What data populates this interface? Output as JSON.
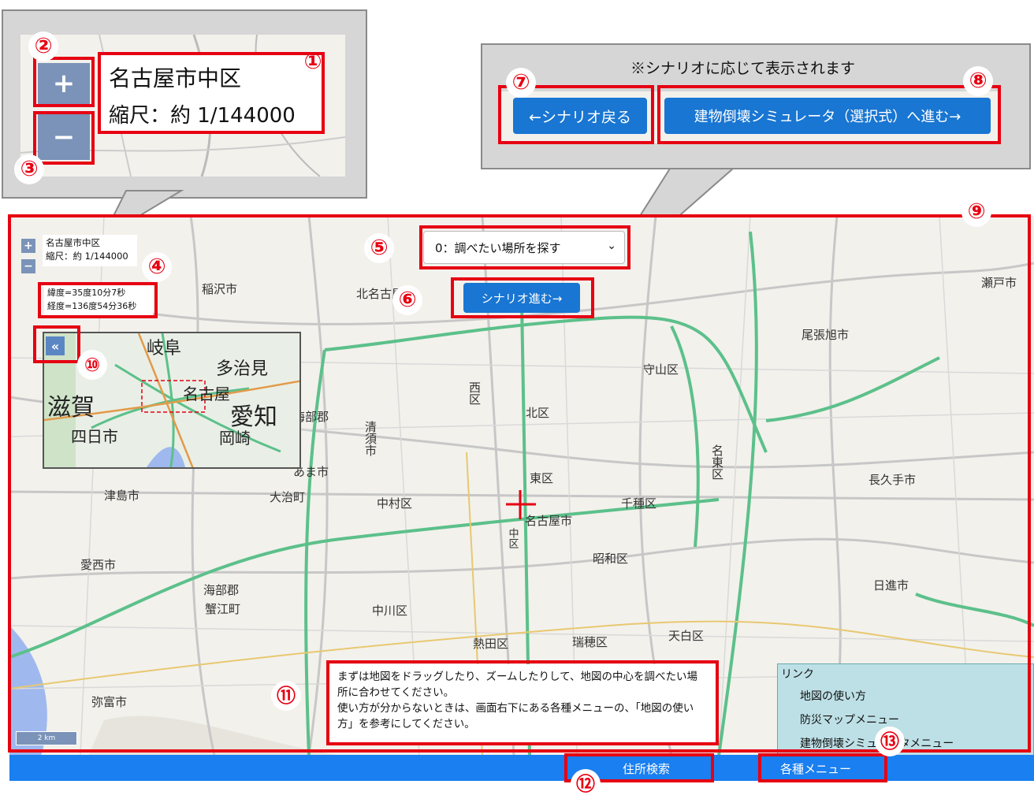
{
  "zoom_callout": {
    "place_name": "名古屋市中区",
    "scale_text": "縮尺：約 1/144000",
    "plus": "+",
    "minus": "−"
  },
  "scenario_callout": {
    "note": "※シナリオに応じて表示されます",
    "back_button": "←シナリオ戻る",
    "forward_button": "建物倒壊シミュレータ（選択式）へ進む→"
  },
  "map": {
    "place_name": "名古屋市中区",
    "scale_text": "縮尺：約 1/144000",
    "latitude": "緯度=35度10分7秒",
    "longitude": "経度=136度54分36秒",
    "scenario_select": "0：調べたい場所を探す",
    "scenario_next": "シナリオ進む→",
    "minimap_collapse": "«",
    "scale_bar": "2 km",
    "instruction_line1": "まずは地図をドラッグしたり、ズームしたりして、地図の中心を調べたい場所に合わせてください。",
    "instruction_line2": "使い方が分からないときは、画面右下にある各種メニューの、「地図の使い方」を参考にしてください。",
    "labels": [
      "稲沢市",
      "北名古屋市",
      "尾張旭市",
      "瀬戸市",
      "清須市",
      "西区",
      "北区",
      "守山区",
      "名東区",
      "長久手市",
      "津島市",
      "大治町",
      "中村区",
      "東区",
      "千種区",
      "名古屋市",
      "愛西市",
      "海部郡",
      "蟹江町",
      "昭和区",
      "中川区",
      "熱田区",
      "瑞穂区",
      "天白区",
      "日進市",
      "弥富市",
      "あま市",
      "中区",
      "海部郡"
    ]
  },
  "minimap": {
    "labels": [
      "岐阜",
      "多治見",
      "名古屋",
      "滋賀",
      "愛知",
      "四日市",
      "岡崎"
    ]
  },
  "link_panel": {
    "title": "リンク",
    "items": [
      "地図の使い方",
      "防災マップメニュー",
      "建物倒壊シミュレータメニュー"
    ]
  },
  "bottom_bar": {
    "address_search": "住所検索",
    "menus": "各種メニュー"
  },
  "callouts": [
    "①",
    "②",
    "③",
    "④",
    "⑤",
    "⑥",
    "⑦",
    "⑧",
    "⑨",
    "⑩",
    "⑪",
    "⑫",
    "⑬"
  ],
  "colors": {
    "accent_red": "#e60012",
    "button_blue": "#1976d2",
    "bar_blue": "#1a7ff0",
    "link_panel": "#bde0e6",
    "road_green": "#5cc08a"
  }
}
